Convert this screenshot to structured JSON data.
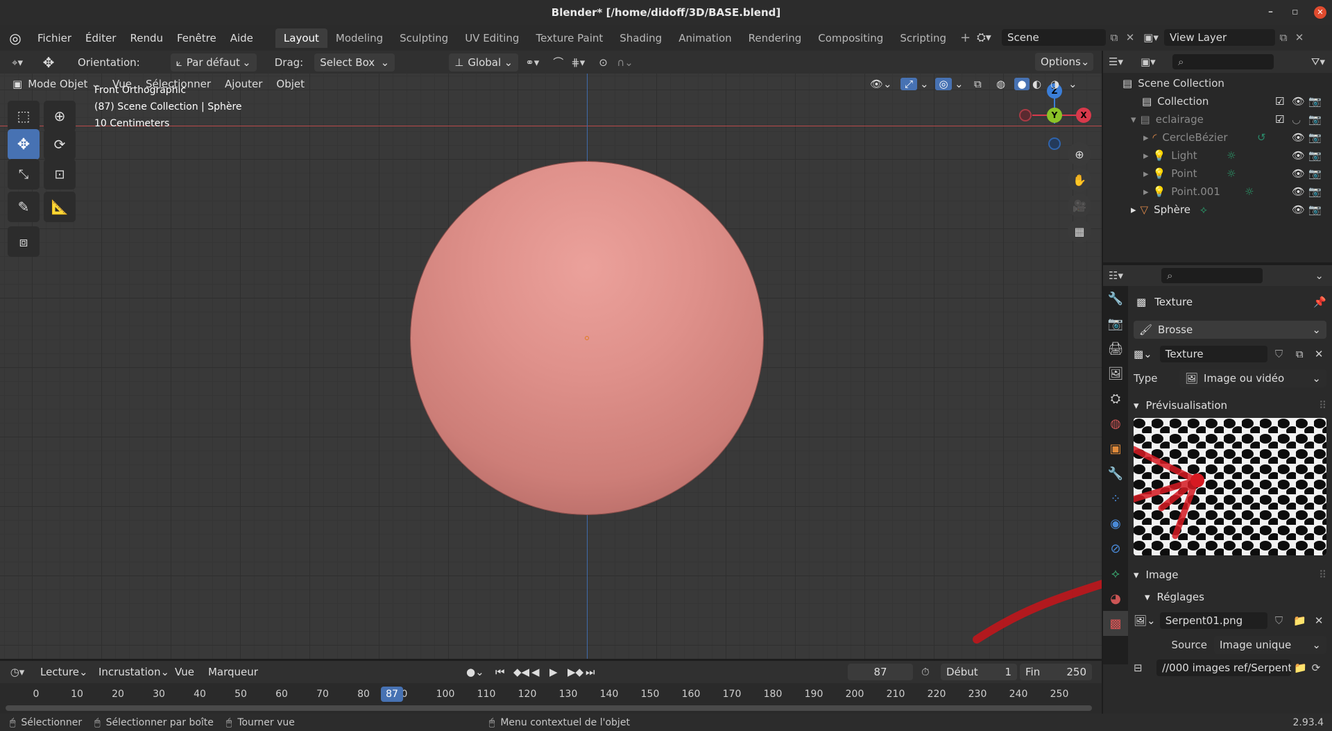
{
  "window": {
    "title": "Blender* [/home/didoff/3D/BASE.blend]",
    "minimize": "–",
    "maximize": "▫",
    "close": "✕"
  },
  "menu": {
    "items": [
      "Fichier",
      "Éditer",
      "Rendu",
      "Fenêtre",
      "Aide"
    ]
  },
  "workspaces": [
    "Layout",
    "Modeling",
    "Sculpting",
    "UV Editing",
    "Texture Paint",
    "Shading",
    "Animation",
    "Rendering",
    "Compositing",
    "Scripting"
  ],
  "scene": {
    "name": "Scene",
    "view_layer": "View Layer"
  },
  "tool_header": {
    "orientation_label": "Orientation:",
    "orientation_value": "Par défaut",
    "drag_label": "Drag:",
    "drag_value": "Select Box",
    "transform": "Global",
    "options": "Options"
  },
  "viewport_header": {
    "mode": "Mode Objet",
    "menus": [
      "Vue",
      "Sélectionner",
      "Ajouter",
      "Objet"
    ]
  },
  "viewport_info": {
    "view": "Front Orthographic",
    "collection": "(87) Scene Collection | Sphère",
    "scale": "10 Centimeters"
  },
  "gizmo": {
    "z": "Z",
    "y": "Y",
    "x": "X"
  },
  "outliner": {
    "root": "Scene Collection",
    "rows": [
      {
        "label": "Collection"
      },
      {
        "label": "eclairage"
      },
      {
        "label": "CercleBézier"
      },
      {
        "label": "Light"
      },
      {
        "label": "Point"
      },
      {
        "label": "Point.001"
      },
      {
        "label": "Sphère"
      }
    ]
  },
  "properties": {
    "context": "Texture",
    "brush": "Brosse",
    "texture_name": "Texture",
    "type_label": "Type",
    "type_value": "Image ou vidéo",
    "preview_label": "Prévisualisation",
    "image_label": "Image",
    "settings_label": "Réglages",
    "image_name": "Serpent01.png",
    "source_label": "Source",
    "source_value": "Image unique",
    "path": "//000 images ref/Serpent..."
  },
  "timeline": {
    "menus": [
      "Lecture",
      "Incrustation",
      "Vue",
      "Marqueur"
    ],
    "current_frame": "87",
    "start_label": "Début",
    "start": "1",
    "end_label": "Fin",
    "end": "250",
    "ticks": [
      "0",
      "10",
      "20",
      "30",
      "40",
      "50",
      "60",
      "70",
      "80",
      "0",
      "100",
      "110",
      "120",
      "130",
      "140",
      "150",
      "160",
      "170",
      "180",
      "190",
      "200",
      "210",
      "220",
      "230",
      "240",
      "250"
    ],
    "playhead": "87"
  },
  "status": {
    "select": "Sélectionner",
    "box": "Sélectionner par boîte",
    "rotate": "Tourner vue",
    "context": "Menu contextuel de l'objet",
    "version": "2.93.4"
  },
  "colors": {
    "accent": "#4772b3",
    "sphere": "#d98d88",
    "x_axis": "#d9394b",
    "y_axis": "#8bc327",
    "z_axis": "#3b7ed8"
  }
}
